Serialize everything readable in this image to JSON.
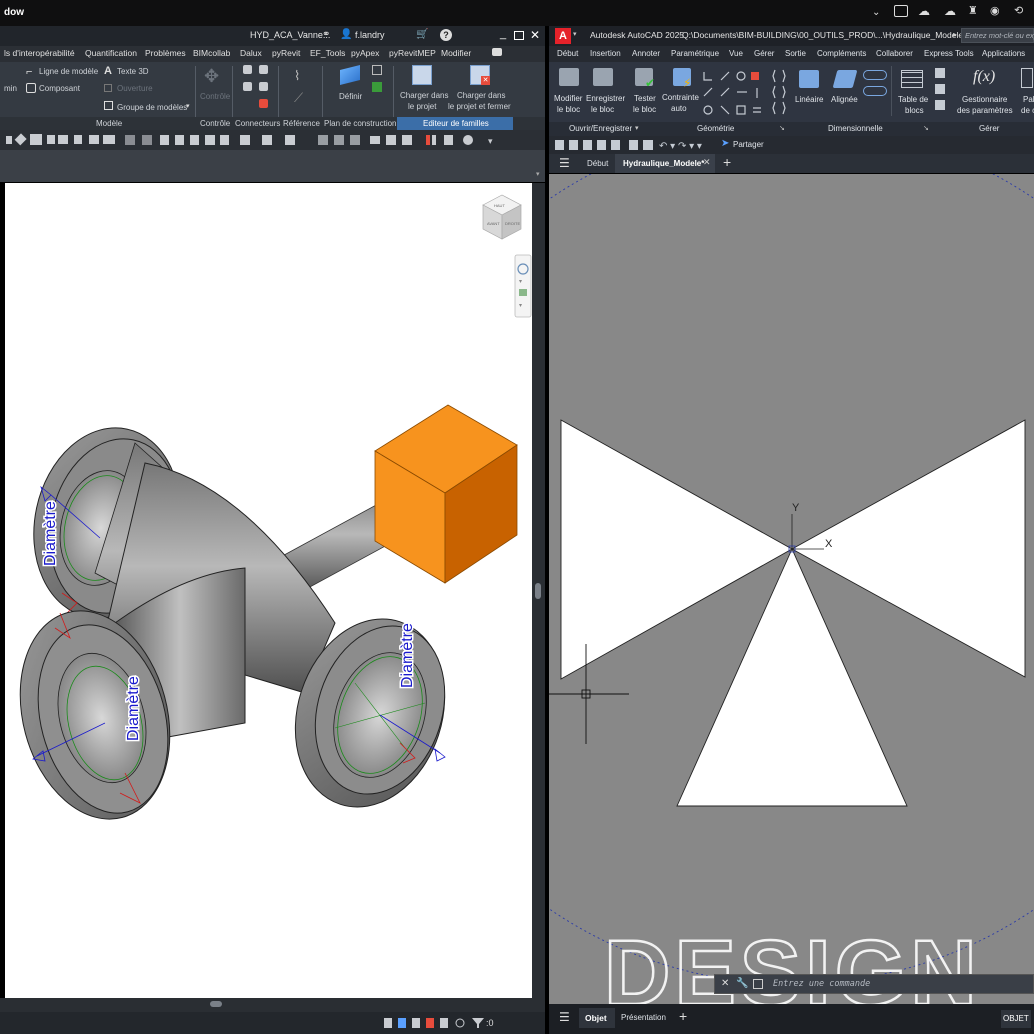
{
  "os": {
    "left_title": "dow"
  },
  "revit": {
    "window_title": "HYD_ACA_Vanne...",
    "user": "f.landry",
    "tabs": [
      "ls d'interopérabilité",
      "Quantification",
      "Problèmes",
      "BIMcollab",
      "Dalux",
      "pyRevit",
      "EF_Tools",
      "pyApex",
      "pyRevitMEP",
      "Modifier"
    ],
    "ribbon": {
      "min_label": "min",
      "ligne_modele": "Ligne de modèle",
      "texte_3d": "Texte 3D",
      "composant": "Composant",
      "ouverture": "Ouverture",
      "groupe_modeles": "Groupe de modèles",
      "controle": "Contrôle",
      "definir": "Définir",
      "charger_projet_1": "Charger dans",
      "charger_projet_2": "le projet",
      "charger_fermer_1": "Charger dans",
      "charger_fermer_2": "le projet et fermer"
    },
    "groups": [
      "Modèle",
      "Contrôle",
      "Connecteurs",
      "Référence",
      "Plan de construction",
      "Editeur de familles"
    ],
    "viewcube_labels": [
      "HAUT",
      "AVANT",
      "DROITE"
    ],
    "annotations": [
      "Diamètre",
      "Diamètre",
      "Diamètre"
    ],
    "status_filter": ":0"
  },
  "acad": {
    "logo": "A",
    "app_title": "Autodesk AutoCAD 2025",
    "file_path": "Q:\\Documents\\BIM-BUILDING\\00_OUTILS_PROD\\...\\Hydraulique_Modele.dwg",
    "search_placeholder": "Entrez mot-clé ou exp",
    "tabs": [
      "Début",
      "Insertion",
      "Annoter",
      "Paramétrique",
      "Vue",
      "Gérer",
      "Sortie",
      "Compléments",
      "Collaborer",
      "Express Tools",
      "Applications"
    ],
    "ribbon": {
      "modifier_1": "Modifier",
      "modifier_2": "le bloc",
      "enregistrer_1": "Enregistrer",
      "enregistrer_2": "le bloc",
      "tester_1": "Tester",
      "tester_2": "le bloc",
      "contrainte_1": "Contrainte",
      "contrainte_2": "auto",
      "lineaire": "Linéaire",
      "alignee": "Alignée",
      "table_1": "Table de",
      "table_2": "blocs",
      "gestionnaire_1": "Gestionnaire",
      "gestionnaire_2": "des paramètres",
      "pal_1": "Pal",
      "pal_2": "de c",
      "fx": "f(x)"
    },
    "groups": [
      "Ouvrir/Enregistrer",
      "Géométrie",
      "Dimensionnelle",
      "Gérer"
    ],
    "share": "Partager",
    "doc_tabs": [
      "Début",
      "Hydraulique_Modele*"
    ],
    "command_placeholder": "Entrez une commande",
    "watermark": "DESIGN",
    "axis_x": "X",
    "axis_y": "Y",
    "layout_tabs": [
      "Objet",
      "Présentation"
    ],
    "status_right": "OBJET"
  },
  "colors": {
    "accent_orange": "#f7931e",
    "acad_red": "#e5222a",
    "annotation_blue": "#1a1acc",
    "canvas_gray": "#888888"
  }
}
